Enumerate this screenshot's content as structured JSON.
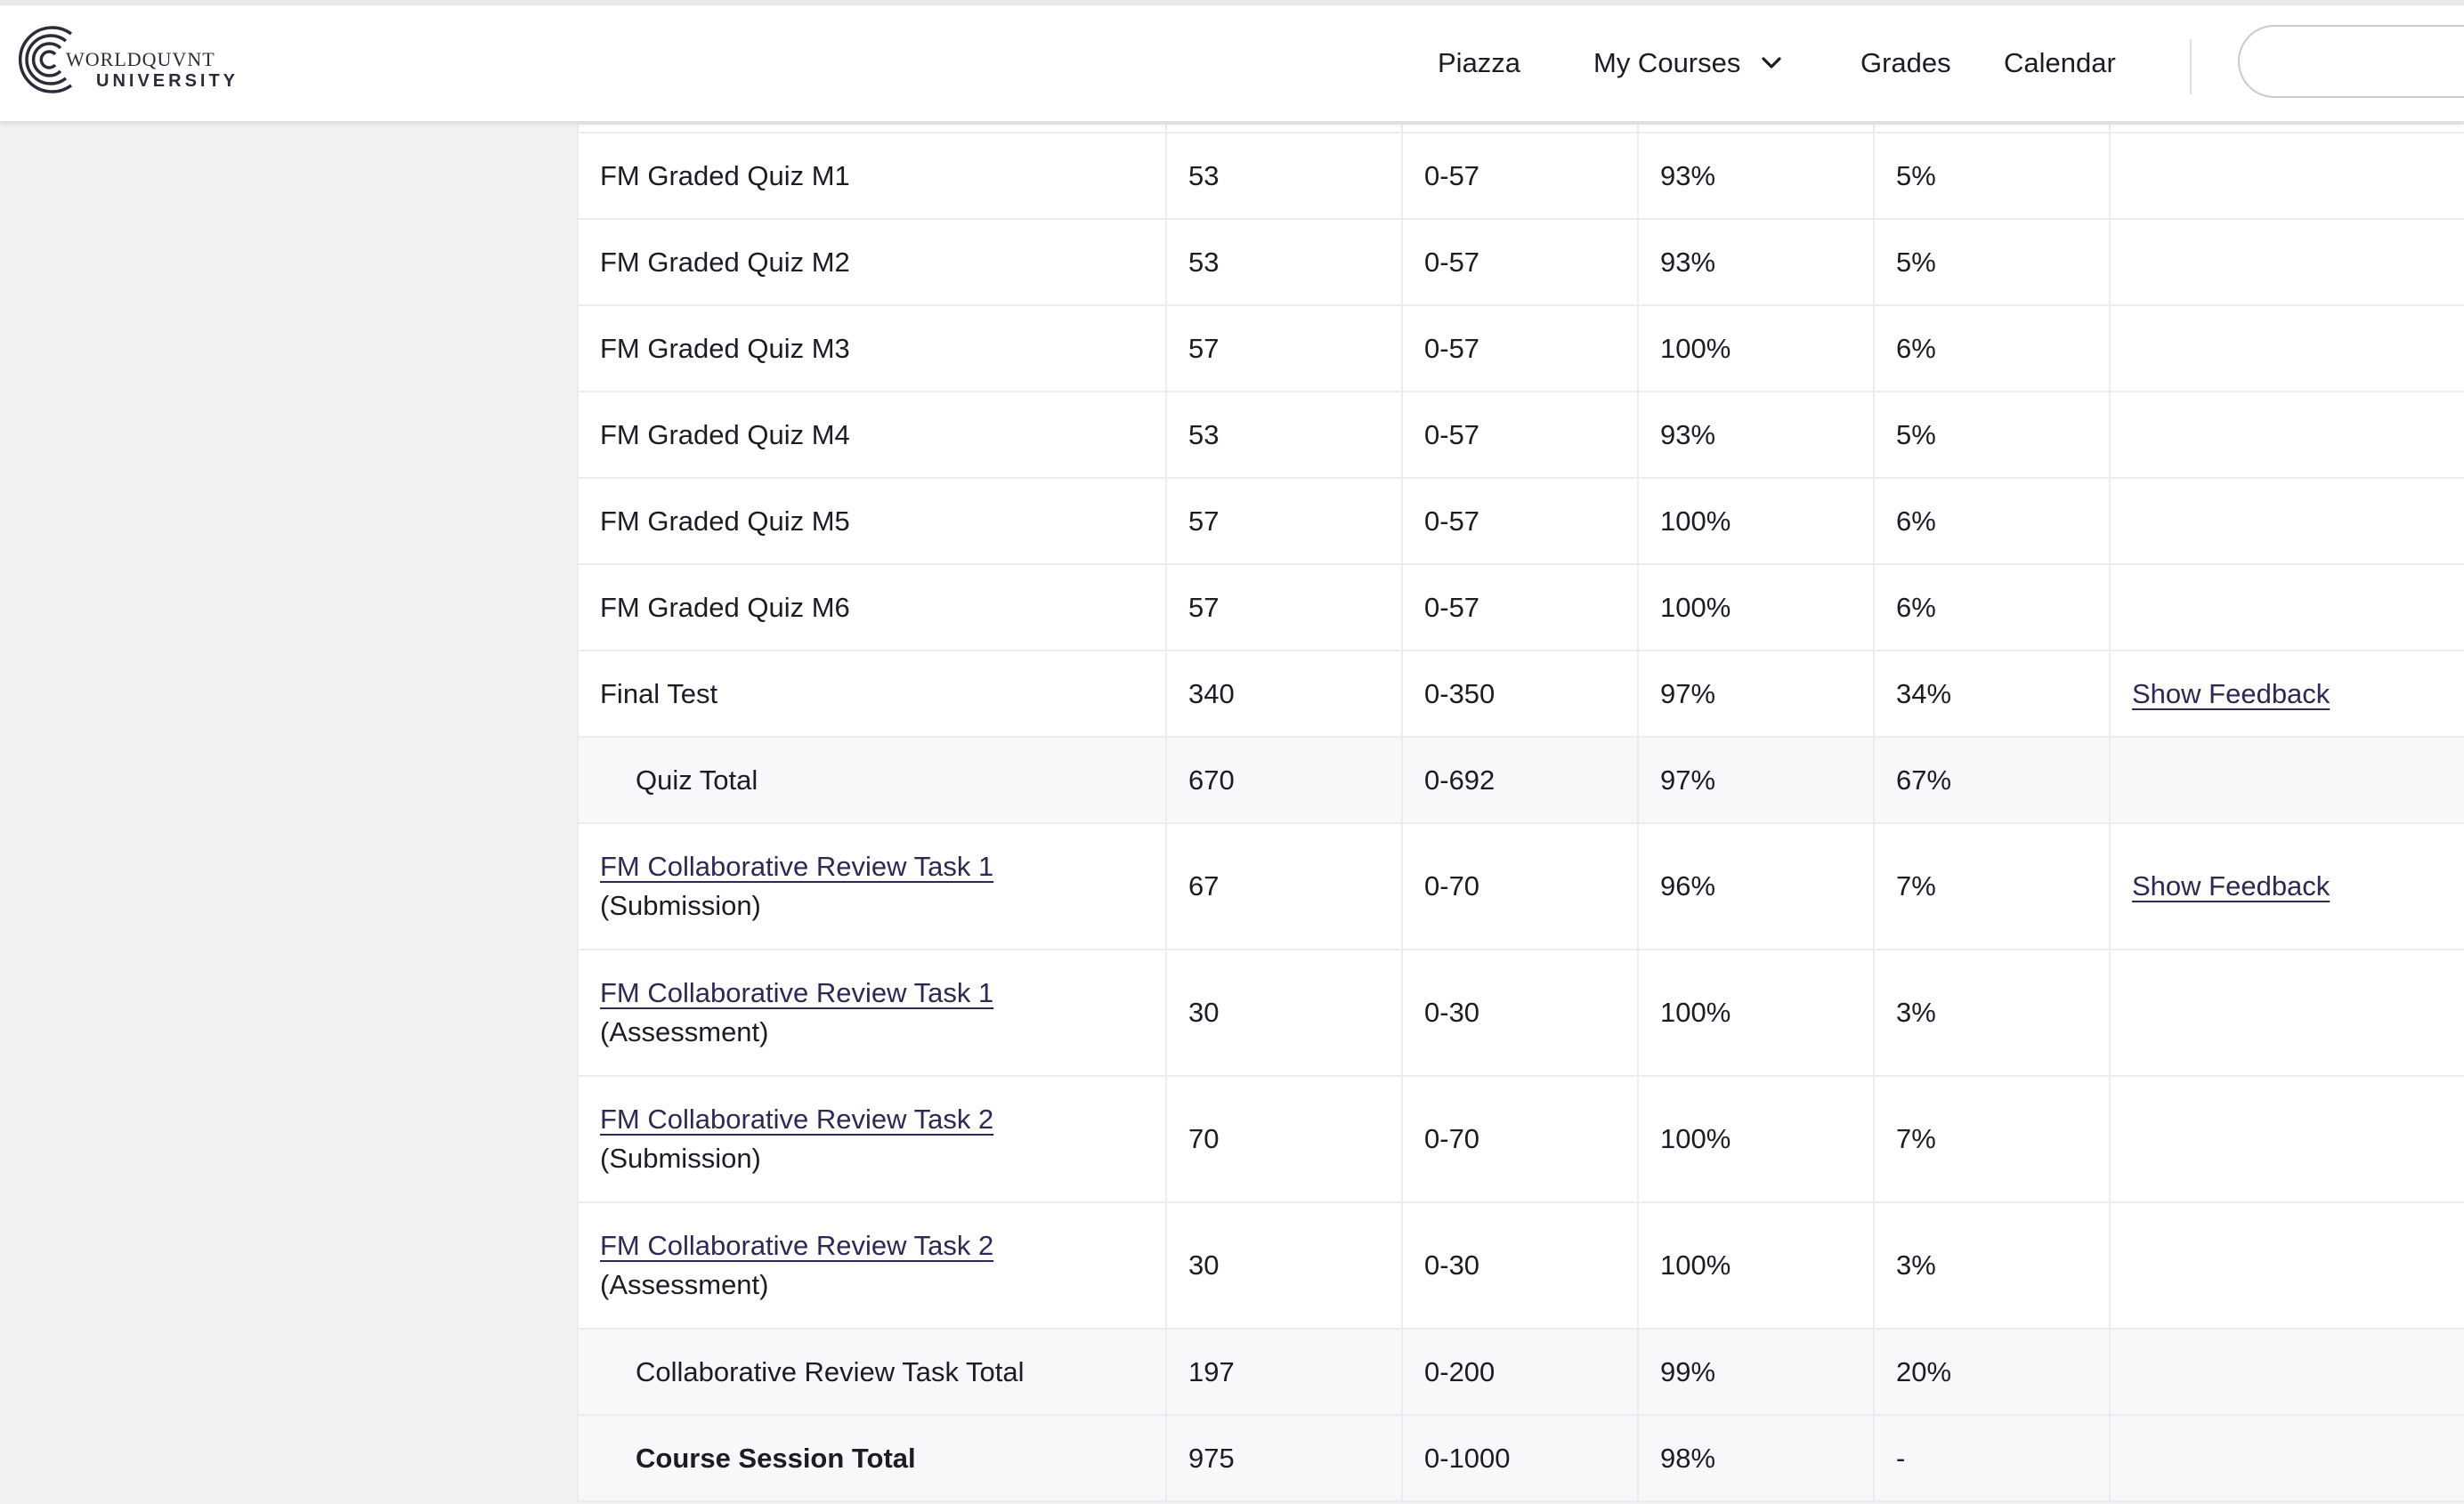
{
  "header": {
    "logo": {
      "brand_top": "WORLDQUVNT",
      "brand_bottom": "UNIVERSITY",
      "icon": "concentric-c-logo-icon"
    },
    "nav": {
      "piazza": "Piazza",
      "my_courses": "My Courses",
      "grades": "Grades",
      "calendar": "Calendar",
      "chevron_icon": "chevron-down-icon"
    }
  },
  "grades_table": {
    "rows": [
      {
        "name": "FM Graded Quiz M1",
        "score": "53",
        "range": "0-57",
        "percent": "93%",
        "weight": "5%",
        "feedback": ""
      },
      {
        "name": "FM Graded Quiz M2",
        "score": "53",
        "range": "0-57",
        "percent": "93%",
        "weight": "5%",
        "feedback": ""
      },
      {
        "name": "FM Graded Quiz M3",
        "score": "57",
        "range": "0-57",
        "percent": "100%",
        "weight": "6%",
        "feedback": ""
      },
      {
        "name": "FM Graded Quiz M4",
        "score": "53",
        "range": "0-57",
        "percent": "93%",
        "weight": "5%",
        "feedback": ""
      },
      {
        "name": "FM Graded Quiz M5",
        "score": "57",
        "range": "0-57",
        "percent": "100%",
        "weight": "6%",
        "feedback": ""
      },
      {
        "name": "FM Graded Quiz M6",
        "score": "57",
        "range": "0-57",
        "percent": "100%",
        "weight": "6%",
        "feedback": ""
      },
      {
        "name": "Final Test",
        "score": "340",
        "range": "0-350",
        "percent": "97%",
        "weight": "34%",
        "feedback": "Show Feedback"
      },
      {
        "name": "Quiz Total",
        "score": "670",
        "range": "0-692",
        "percent": "97%",
        "weight": "67%",
        "feedback": ""
      },
      {
        "name_link": "FM Collaborative Review Task 1",
        "name_sub": "(Submission)",
        "score": "67",
        "range": "0-70",
        "percent": "96%",
        "weight": "7%",
        "feedback": "Show Feedback"
      },
      {
        "name_link": "FM Collaborative Review Task 1",
        "name_sub": "(Assessment)",
        "score": "30",
        "range": "0-30",
        "percent": "100%",
        "weight": "3%",
        "feedback": ""
      },
      {
        "name_link": "FM Collaborative Review Task 2",
        "name_sub": "(Submission)",
        "score": "70",
        "range": "0-70",
        "percent": "100%",
        "weight": "7%",
        "feedback": ""
      },
      {
        "name_link": "FM Collaborative Review Task 2",
        "name_sub": "(Assessment)",
        "score": "30",
        "range": "0-30",
        "percent": "100%",
        "weight": "3%",
        "feedback": ""
      },
      {
        "name": "Collaborative Review Task Total",
        "score": "197",
        "range": "0-200",
        "percent": "99%",
        "weight": "20%",
        "feedback": ""
      },
      {
        "name": "Course Session Total",
        "score": "975",
        "range": "0-1000",
        "percent": "98%",
        "weight": "-",
        "feedback": ""
      }
    ]
  }
}
